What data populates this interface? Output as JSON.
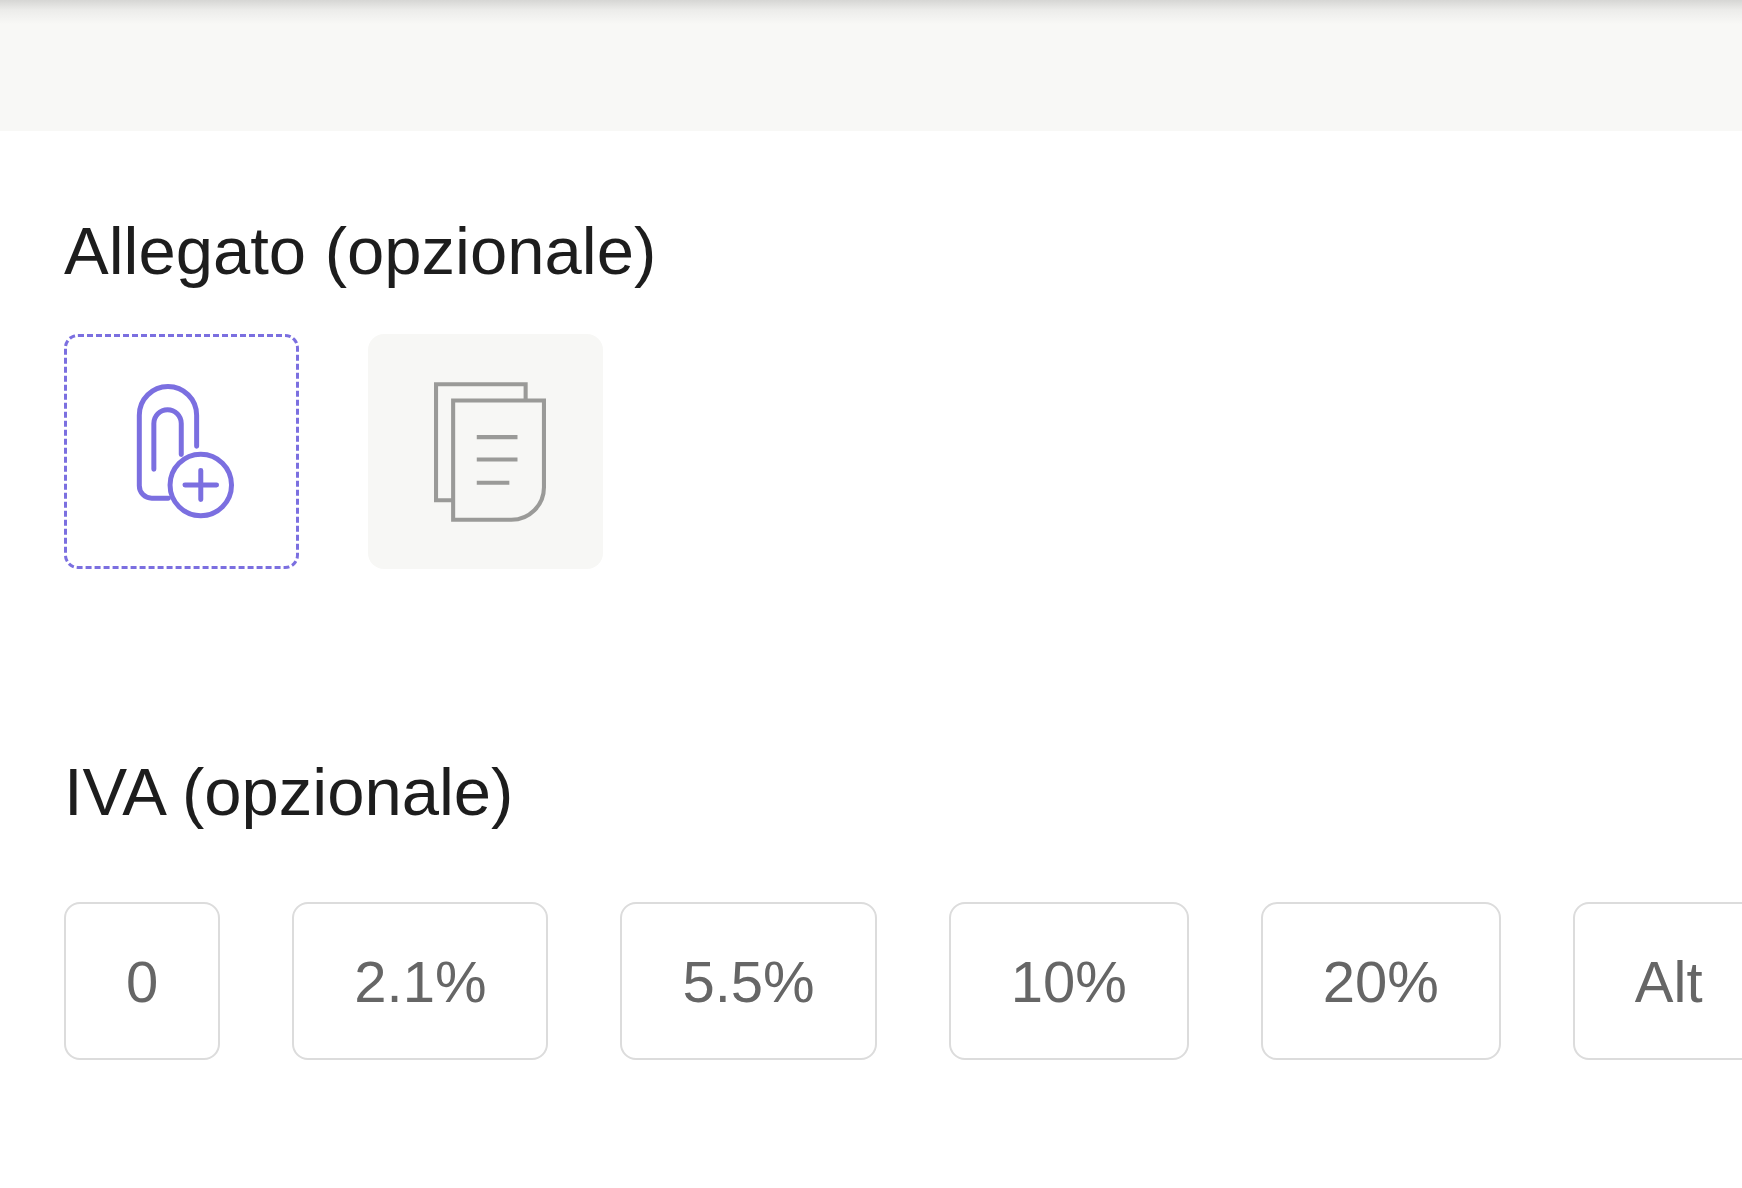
{
  "attachment": {
    "title": "Allegato (opzionale)"
  },
  "vat": {
    "title": "IVA (opzionale)",
    "rates": [
      {
        "label": "0",
        "selected": false
      },
      {
        "label": "2.1%",
        "selected": false
      },
      {
        "label": "5.5%",
        "selected": false
      },
      {
        "label": "10%",
        "selected": false
      },
      {
        "label": "20%",
        "selected": false
      },
      {
        "label": "Alt",
        "selected": false
      }
    ]
  }
}
